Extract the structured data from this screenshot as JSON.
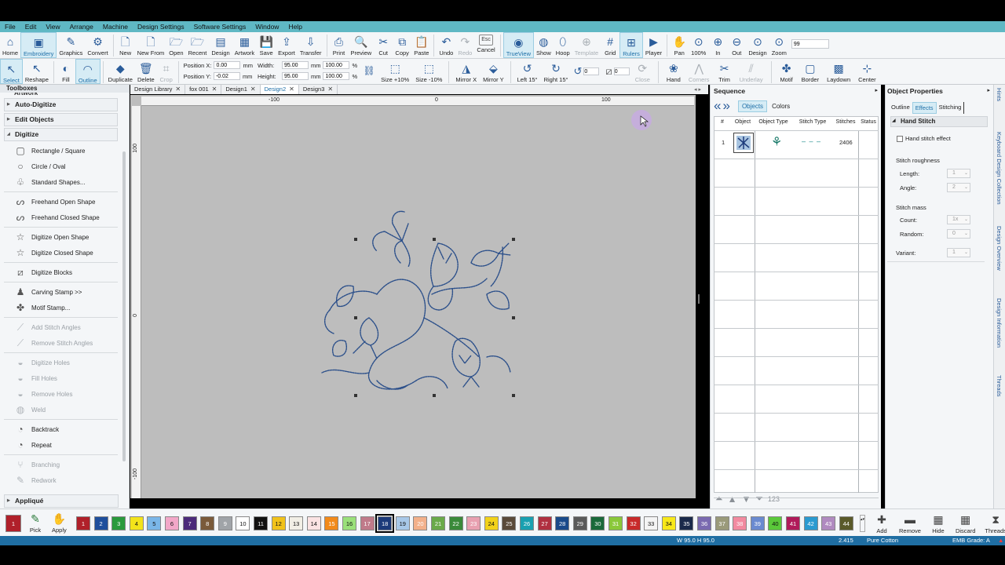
{
  "menu": [
    "File",
    "Edit",
    "View",
    "Arrange",
    "Machine",
    "Design Settings",
    "Software Settings",
    "Window",
    "Help"
  ],
  "toolbar1": [
    {
      "label": "Home",
      "icon": "home-icon",
      "glyph": "⌂"
    },
    {
      "label": "Embroidery",
      "icon": "embroidery-icon",
      "glyph": "▣",
      "active": true
    },
    {
      "label": "Graphics",
      "icon": "pencil-icon",
      "glyph": "✎"
    },
    {
      "label": "Convert",
      "icon": "convert-icon",
      "glyph": "⚙"
    },
    {
      "label": "New",
      "icon": "new-file-icon",
      "glyph": "🗋"
    },
    {
      "label": "New From",
      "icon": "new-from-icon",
      "glyph": "🗋"
    },
    {
      "label": "Open",
      "icon": "folder-open-icon",
      "glyph": "🗁"
    },
    {
      "label": "Recent",
      "icon": "recent-folder-icon",
      "glyph": "🗁"
    },
    {
      "label": "Design",
      "icon": "design-icon",
      "glyph": "▤"
    },
    {
      "label": "Artwork",
      "icon": "artwork-icon",
      "glyph": "▦"
    },
    {
      "label": "Save",
      "icon": "save-icon",
      "glyph": "💾"
    },
    {
      "label": "Export",
      "icon": "export-icon",
      "glyph": "⇪"
    },
    {
      "label": "Transfer",
      "icon": "transfer-icon",
      "glyph": "⇩"
    },
    {
      "label": "Print",
      "icon": "print-icon",
      "glyph": "⎙"
    },
    {
      "label": "Preview",
      "icon": "preview-icon",
      "glyph": "🔍"
    },
    {
      "label": "Cut",
      "icon": "scissors-icon",
      "glyph": "✂"
    },
    {
      "label": "Copy",
      "icon": "copy-icon",
      "glyph": "⧉"
    },
    {
      "label": "Paste",
      "icon": "paste-icon",
      "glyph": "📋"
    },
    {
      "label": "Undo",
      "icon": "undo-icon",
      "glyph": "↶"
    },
    {
      "label": "Redo",
      "icon": "redo-icon",
      "glyph": "↷",
      "dim": true
    },
    {
      "label": "Cancel",
      "icon": "esc-icon",
      "glyph": "Esc"
    },
    {
      "label": "TrueView",
      "icon": "trueview-icon",
      "glyph": "◉",
      "active": true
    },
    {
      "label": "Show",
      "icon": "show-icon",
      "glyph": "◍"
    },
    {
      "label": "Hoop",
      "icon": "hoop-icon",
      "glyph": "⬯"
    },
    {
      "label": "Template",
      "icon": "template-icon",
      "glyph": "⊕",
      "dim": true
    },
    {
      "label": "Grid",
      "icon": "grid-icon",
      "glyph": "#"
    },
    {
      "label": "Rulers",
      "icon": "rulers-icon",
      "glyph": "⊞",
      "active": true
    },
    {
      "label": "Player",
      "icon": "player-icon",
      "glyph": "▶"
    },
    {
      "label": "Pan",
      "icon": "pan-hand-icon",
      "glyph": "✋"
    },
    {
      "label": "100%",
      "icon": "zoom-100-icon",
      "glyph": "⊙"
    },
    {
      "label": "In",
      "icon": "zoom-in-icon",
      "glyph": "⊕"
    },
    {
      "label": "Out",
      "icon": "zoom-out-icon",
      "glyph": "⊖"
    },
    {
      "label": "Design",
      "icon": "zoom-design-icon",
      "glyph": "⊙"
    },
    {
      "label": "Zoom",
      "icon": "zoom-icon",
      "glyph": "⊙"
    }
  ],
  "zoom_value": "99",
  "toolbar2_left": [
    {
      "label": "Select",
      "icon": "select-arrow-icon",
      "glyph": "↖",
      "active": true
    },
    {
      "label": "Reshape",
      "icon": "reshape-icon",
      "glyph": "↖"
    },
    {
      "label": "Fill",
      "icon": "fill-icon",
      "glyph": "◐"
    },
    {
      "label": "Outline",
      "icon": "outline-icon",
      "glyph": "◠",
      "active": true
    },
    {
      "label": "Duplicate",
      "icon": "duplicate-icon",
      "glyph": "◆"
    },
    {
      "label": "Delete",
      "icon": "delete-icon",
      "glyph": "🗑"
    },
    {
      "label": "Crop",
      "icon": "crop-icon",
      "glyph": "⌗",
      "dim": true
    }
  ],
  "position": {
    "x_label": "Position X:",
    "x": "0.00",
    "y_label": "Position Y:",
    "y": "-0.02",
    "unit": "mm"
  },
  "size": {
    "w_label": "Width:",
    "w": "95.00",
    "h_label": "Height:",
    "h": "95.00",
    "unit": "mm",
    "wp": "100.00",
    "hp": "100.00",
    "pct": "%"
  },
  "toolbar2_right": [
    {
      "label": "Size +10%",
      "icon": "size-plus-icon",
      "glyph": "⬚"
    },
    {
      "label": "Size -10%",
      "icon": "size-minus-icon",
      "glyph": "⬚"
    },
    {
      "label": "Mirror X",
      "icon": "mirror-x-icon",
      "glyph": "◮"
    },
    {
      "label": "Mirror Y",
      "icon": "mirror-y-icon",
      "glyph": "⬙"
    },
    {
      "label": "Left 15°",
      "icon": "rotate-left-icon",
      "glyph": "↺"
    },
    {
      "label": "Right 15°",
      "icon": "rotate-right-icon",
      "glyph": "↻"
    }
  ],
  "rotate_value": "0",
  "slant_value": "0",
  "toolbar2_far": [
    {
      "label": "Close",
      "icon": "close-shape-icon",
      "glyph": "⟳",
      "dim": true
    },
    {
      "label": "Hand",
      "icon": "hand-stitch-icon",
      "glyph": "❀"
    },
    {
      "label": "Corners",
      "icon": "corners-icon",
      "glyph": "⋀",
      "dim": true
    },
    {
      "label": "Trim",
      "icon": "trim-icon",
      "glyph": "✂"
    },
    {
      "label": "Underlay",
      "icon": "underlay-icon",
      "glyph": "⫽",
      "dim": true
    },
    {
      "label": "Motif",
      "icon": "motif-icon",
      "glyph": "✤"
    },
    {
      "label": "Border",
      "icon": "border-icon",
      "glyph": "▢"
    },
    {
      "label": "Laydown",
      "icon": "laydown-icon",
      "glyph": "▩"
    },
    {
      "label": "Center",
      "icon": "center-icon",
      "glyph": "⊹"
    }
  ],
  "toolboxes": {
    "title": "Toolboxes",
    "cut_label": "Artwork",
    "groups": [
      "Auto-Digitize",
      "Edit Objects",
      "Digitize"
    ],
    "items": [
      {
        "label": "Rectangle / Square",
        "icon": "rectangle-icon",
        "glyph": "▢"
      },
      {
        "label": "Circle / Oval",
        "icon": "circle-icon",
        "glyph": "○"
      },
      {
        "label": "Standard Shapes...",
        "icon": "shapes-icon",
        "glyph": "♧"
      },
      {
        "sep": true
      },
      {
        "label": "Freehand Open Shape",
        "icon": "freehand-open-icon",
        "glyph": "ᔕ"
      },
      {
        "label": "Freehand Closed Shape",
        "icon": "freehand-closed-icon",
        "glyph": "ᔕ"
      },
      {
        "sep": true
      },
      {
        "label": "Digitize Open Shape",
        "icon": "star-open-icon",
        "glyph": "☆"
      },
      {
        "label": "Digitize Closed Shape",
        "icon": "star-closed-icon",
        "glyph": "☆"
      },
      {
        "sep": true
      },
      {
        "label": "Digitize Blocks",
        "icon": "blocks-icon",
        "glyph": "⧄"
      },
      {
        "sep": true
      },
      {
        "label": "Carving Stamp >>",
        "icon": "stamp-icon",
        "glyph": "♟"
      },
      {
        "label": "Motif Stamp...",
        "icon": "motif-stamp-icon",
        "glyph": "✤"
      },
      {
        "sep": true
      },
      {
        "label": "Add Stitch Angles",
        "icon": "add-angles-icon",
        "glyph": "⟋",
        "dim": true
      },
      {
        "label": "Remove Stitch Angles",
        "icon": "remove-angles-icon",
        "glyph": "⟋",
        "dim": true
      },
      {
        "sep": true
      },
      {
        "label": "Digitize Holes",
        "icon": "holes-icon",
        "glyph": "◒",
        "dim": true
      },
      {
        "label": "Fill Holes",
        "icon": "fill-holes-icon",
        "glyph": "◒",
        "dim": true
      },
      {
        "label": "Remove Holes",
        "icon": "remove-holes-icon",
        "glyph": "◒",
        "dim": true
      },
      {
        "label": "Weld",
        "icon": "weld-icon",
        "glyph": "◍",
        "dim": true
      },
      {
        "sep": true
      },
      {
        "label": "Backtrack",
        "icon": "backtrack-icon",
        "glyph": "◔"
      },
      {
        "label": "Repeat",
        "icon": "repeat-icon",
        "glyph": "◔"
      },
      {
        "sep": true
      },
      {
        "label": "Branching",
        "icon": "branching-icon",
        "glyph": "⑂",
        "dim": true
      },
      {
        "label": "Redwork",
        "icon": "redwork-icon",
        "glyph": "✎",
        "dim": true
      }
    ],
    "bottom_group": "Appliqué"
  },
  "tabs": [
    "Design Library",
    "fox 001",
    "Design1",
    "Design2",
    "Design3"
  ],
  "active_tab": 3,
  "ruler": {
    "h": [
      "-100",
      "0",
      "100"
    ],
    "v": [
      "100",
      "0",
      "-100"
    ]
  },
  "sequence": {
    "title": "Sequence",
    "tabs": [
      "Objects",
      "Colors"
    ],
    "headers": [
      "#",
      "Object",
      "Object Type",
      "Stitch Type",
      "Stitches",
      "Status"
    ],
    "row": {
      "num": "1",
      "stitches": "2406"
    }
  },
  "properties": {
    "title": "Object Properties",
    "tabs": [
      "Outline",
      "Effects",
      "Stitching"
    ],
    "section": "Hand Stitch",
    "checkbox": "Hand stitch effect",
    "roughness": "Stitch roughness",
    "length_label": "Length:",
    "length": "1",
    "angle_label": "Angle:",
    "angle": "2",
    "mass": "Stitch mass",
    "count_label": "Count:",
    "count": "1x",
    "random_label": "Random:",
    "random": "0",
    "variant_label": "Variant:",
    "variant": "1"
  },
  "right_tabs": [
    "Hints",
    "Keyboard Design Collection",
    "Design Overview",
    "Design Information",
    "Threads"
  ],
  "palette": {
    "current": "1",
    "pick": "Pick",
    "apply": "Apply",
    "chips": [
      {
        "n": "1",
        "c": "#b0202a",
        "t": "#fff"
      },
      {
        "n": "2",
        "c": "#1f4f9c",
        "t": "#fff"
      },
      {
        "n": "3",
        "c": "#2a9a3c",
        "t": "#fff"
      },
      {
        "n": "4",
        "c": "#f3e31a",
        "t": "#111"
      },
      {
        "n": "5",
        "c": "#7ab6e8",
        "t": "#111"
      },
      {
        "n": "6",
        "c": "#f2a7c8",
        "t": "#111"
      },
      {
        "n": "7",
        "c": "#4b2a7a",
        "t": "#fff"
      },
      {
        "n": "8",
        "c": "#7a5a3a",
        "t": "#fff"
      },
      {
        "n": "9",
        "c": "#a0a4a8",
        "t": "#fff"
      },
      {
        "n": "10",
        "c": "#ffffff",
        "t": "#111"
      },
      {
        "n": "11",
        "c": "#111111",
        "t": "#fff"
      },
      {
        "n": "12",
        "c": "#f1c21a",
        "t": "#111"
      },
      {
        "n": "13",
        "c": "#f2efe6",
        "t": "#111"
      },
      {
        "n": "14",
        "c": "#fbe3e3",
        "t": "#111"
      },
      {
        "n": "15",
        "c": "#f28a1a",
        "t": "#fff"
      },
      {
        "n": "16",
        "c": "#9ae07a",
        "t": "#111"
      },
      {
        "n": "17",
        "c": "#c07a8a",
        "t": "#fff"
      },
      {
        "n": "18",
        "c": "#1c3a7a",
        "t": "#fff",
        "sel": true
      },
      {
        "n": "19",
        "c": "#a8c8e8",
        "t": "#111"
      },
      {
        "n": "20",
        "c": "#f2b08a",
        "t": "#fff"
      },
      {
        "n": "21",
        "c": "#6aaa4a",
        "t": "#fff"
      },
      {
        "n": "22",
        "c": "#3a8a3a",
        "t": "#fff"
      },
      {
        "n": "23",
        "c": "#e8a0b0",
        "t": "#fff"
      },
      {
        "n": "24",
        "c": "#f2d21a",
        "t": "#111"
      },
      {
        "n": "25",
        "c": "#5a4a3a",
        "t": "#fff"
      },
      {
        "n": "26",
        "c": "#1aa0b0",
        "t": "#fff"
      },
      {
        "n": "27",
        "c": "#b03040",
        "t": "#fff"
      },
      {
        "n": "28",
        "c": "#1a4a8a",
        "t": "#fff"
      },
      {
        "n": "29",
        "c": "#5a5a5a",
        "t": "#fff"
      },
      {
        "n": "30",
        "c": "#1a6a3a",
        "t": "#fff"
      },
      {
        "n": "31",
        "c": "#8ac83a",
        "t": "#fff"
      },
      {
        "n": "32",
        "c": "#c82a2a",
        "t": "#fff"
      },
      {
        "n": "33",
        "c": "#f4f4f4",
        "t": "#111"
      },
      {
        "n": "34",
        "c": "#f8e81a",
        "t": "#111"
      },
      {
        "n": "35",
        "c": "#1a2a4a",
        "t": "#fff"
      },
      {
        "n": "36",
        "c": "#7a6ab0",
        "t": "#fff"
      },
      {
        "n": "37",
        "c": "#9a9a7a",
        "t": "#fff"
      },
      {
        "n": "38",
        "c": "#f28aa0",
        "t": "#fff"
      },
      {
        "n": "39",
        "c": "#6a8ad0",
        "t": "#fff"
      },
      {
        "n": "40",
        "c": "#5ac83a",
        "t": "#111"
      },
      {
        "n": "41",
        "c": "#b01a5a",
        "t": "#fff"
      },
      {
        "n": "42",
        "c": "#2a9ad0",
        "t": "#fff"
      },
      {
        "n": "43",
        "c": "#b08ac0",
        "t": "#fff"
      },
      {
        "n": "44",
        "c": "#5a5a2a",
        "t": "#fff"
      }
    ],
    "actions": [
      {
        "label": "Add",
        "icon": "add-icon",
        "glyph": "✚"
      },
      {
        "label": "Remove",
        "icon": "remove-icon",
        "glyph": "▬"
      },
      {
        "label": "Hide",
        "icon": "hide-icon",
        "glyph": "▦"
      },
      {
        "label": "Discard",
        "icon": "discard-icon",
        "glyph": "▦"
      },
      {
        "label": "Threads",
        "icon": "threads-icon",
        "glyph": "⧗"
      }
    ]
  },
  "status": {
    "dims": "W 95.0 H 95.0",
    "value": "2.415",
    "thread": "Pure Cotton",
    "grade": "EMB Grade: A"
  },
  "colors": {
    "menubar": "#5fb8c4",
    "status": "#1f6ea3",
    "accent": "#1e6fa8",
    "stitch": "#2b4f8a"
  }
}
